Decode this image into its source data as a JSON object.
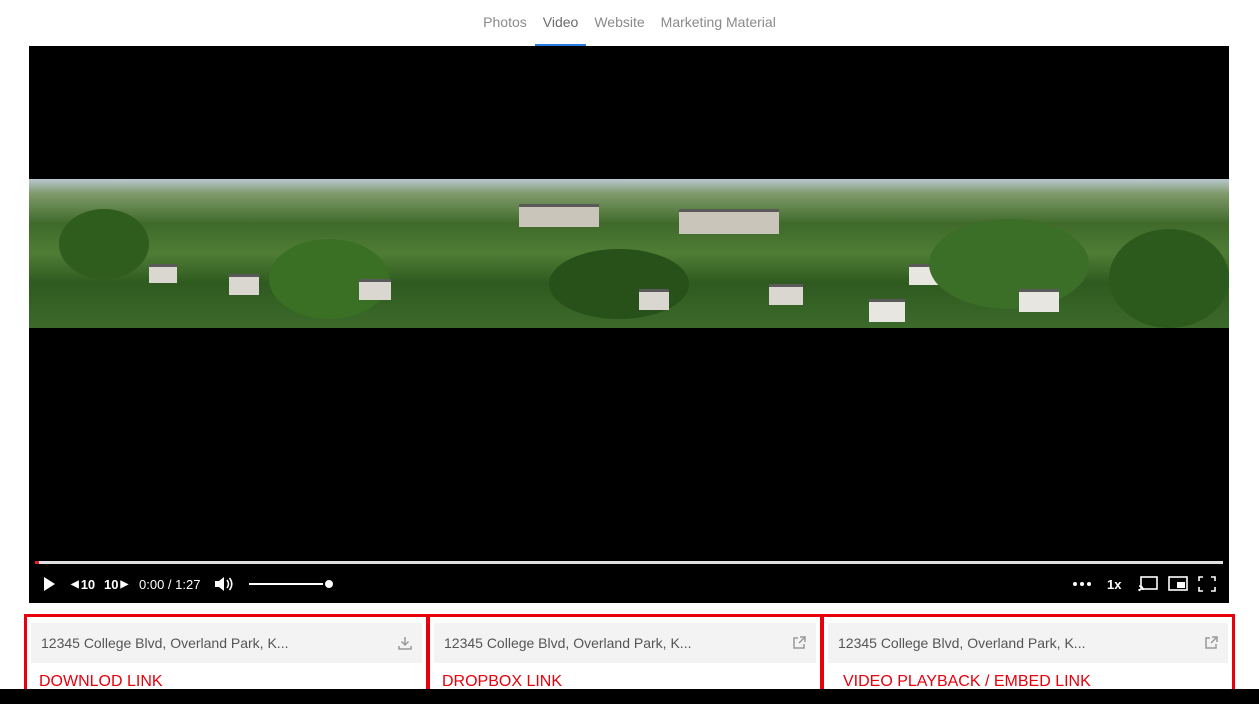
{
  "tabs": [
    {
      "label": "Photos"
    },
    {
      "label": "Video"
    },
    {
      "label": "Website"
    },
    {
      "label": "Marketing Material"
    }
  ],
  "active_tab": "Video",
  "player": {
    "rewind_label": "10",
    "forward_label": "10",
    "time": "0:00 / 1:27",
    "speed": "1x",
    "progress_fraction": 0.003,
    "volume_fraction": 1.0,
    "accent_color": "#e02020"
  },
  "links": [
    {
      "value": "12345 College Blvd, Overland Park, K...",
      "icon": "download-icon",
      "caption": "DOWNLOD LINK"
    },
    {
      "value": "12345 College Blvd, Overland Park, K...",
      "icon": "external-link-icon",
      "caption": "DROPBOX LINK"
    },
    {
      "value": "12345 College Blvd, Overland Park, K...",
      "icon": "external-link-icon",
      "caption": "VIDEO PLAYBACK / EMBED LINK"
    }
  ],
  "annotation_color": "#e8000b"
}
